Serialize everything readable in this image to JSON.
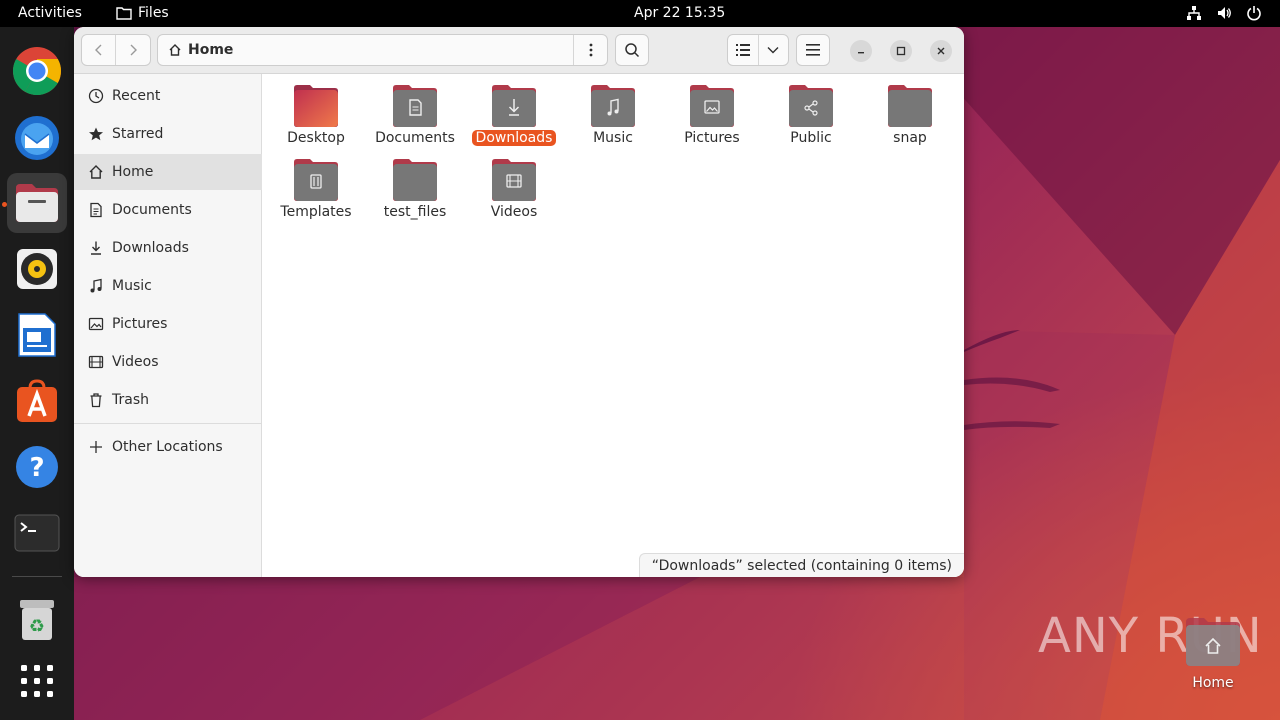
{
  "topbar": {
    "activities": "Activities",
    "app_name": "Files",
    "clock": "Apr 22  15:35",
    "tray_icons": [
      "network-icon",
      "volume-icon",
      "power-icon"
    ]
  },
  "dock": {
    "items": [
      {
        "name": "chrome-icon"
      },
      {
        "name": "thunderbird-icon"
      },
      {
        "name": "files-icon",
        "active": true
      },
      {
        "name": "rhythmbox-icon"
      },
      {
        "name": "libreoffice-writer-icon"
      },
      {
        "name": "software-center-icon"
      },
      {
        "name": "help-icon"
      },
      {
        "name": "terminal-icon"
      },
      {
        "name": "trash-icon"
      },
      {
        "name": "show-apps-icon"
      }
    ]
  },
  "window": {
    "path_label": "Home",
    "sidebar": {
      "items": [
        {
          "label": "Recent",
          "icon": "clock-icon"
        },
        {
          "label": "Starred",
          "icon": "star-icon"
        },
        {
          "label": "Home",
          "icon": "home-icon",
          "selected": true
        },
        {
          "label": "Documents",
          "icon": "document-icon"
        },
        {
          "label": "Downloads",
          "icon": "download-icon"
        },
        {
          "label": "Music",
          "icon": "music-icon"
        },
        {
          "label": "Pictures",
          "icon": "picture-icon"
        },
        {
          "label": "Videos",
          "icon": "video-icon"
        },
        {
          "label": "Trash",
          "icon": "trash-icon"
        }
      ],
      "other_locations": "Other Locations"
    },
    "folders": [
      {
        "label": "Desktop",
        "icon": "desktop-folder-icon"
      },
      {
        "label": "Documents",
        "icon": "documents-folder-icon"
      },
      {
        "label": "Downloads",
        "icon": "downloads-folder-icon",
        "selected": true
      },
      {
        "label": "Music",
        "icon": "music-folder-icon"
      },
      {
        "label": "Pictures",
        "icon": "pictures-folder-icon"
      },
      {
        "label": "Public",
        "icon": "public-folder-icon"
      },
      {
        "label": "snap",
        "icon": "folder-icon"
      },
      {
        "label": "Templates",
        "icon": "templates-folder-icon"
      },
      {
        "label": "test_files",
        "icon": "folder-icon"
      },
      {
        "label": "Videos",
        "icon": "videos-folder-icon"
      }
    ],
    "status": "“Downloads” selected  (containing 0 items)"
  },
  "desktop": {
    "home_label": "Home",
    "watermark": "ANY RUN"
  },
  "colors": {
    "accent": "#e95420",
    "folder_body": "#7a7a7a",
    "folder_tab": "#b03a4a"
  }
}
